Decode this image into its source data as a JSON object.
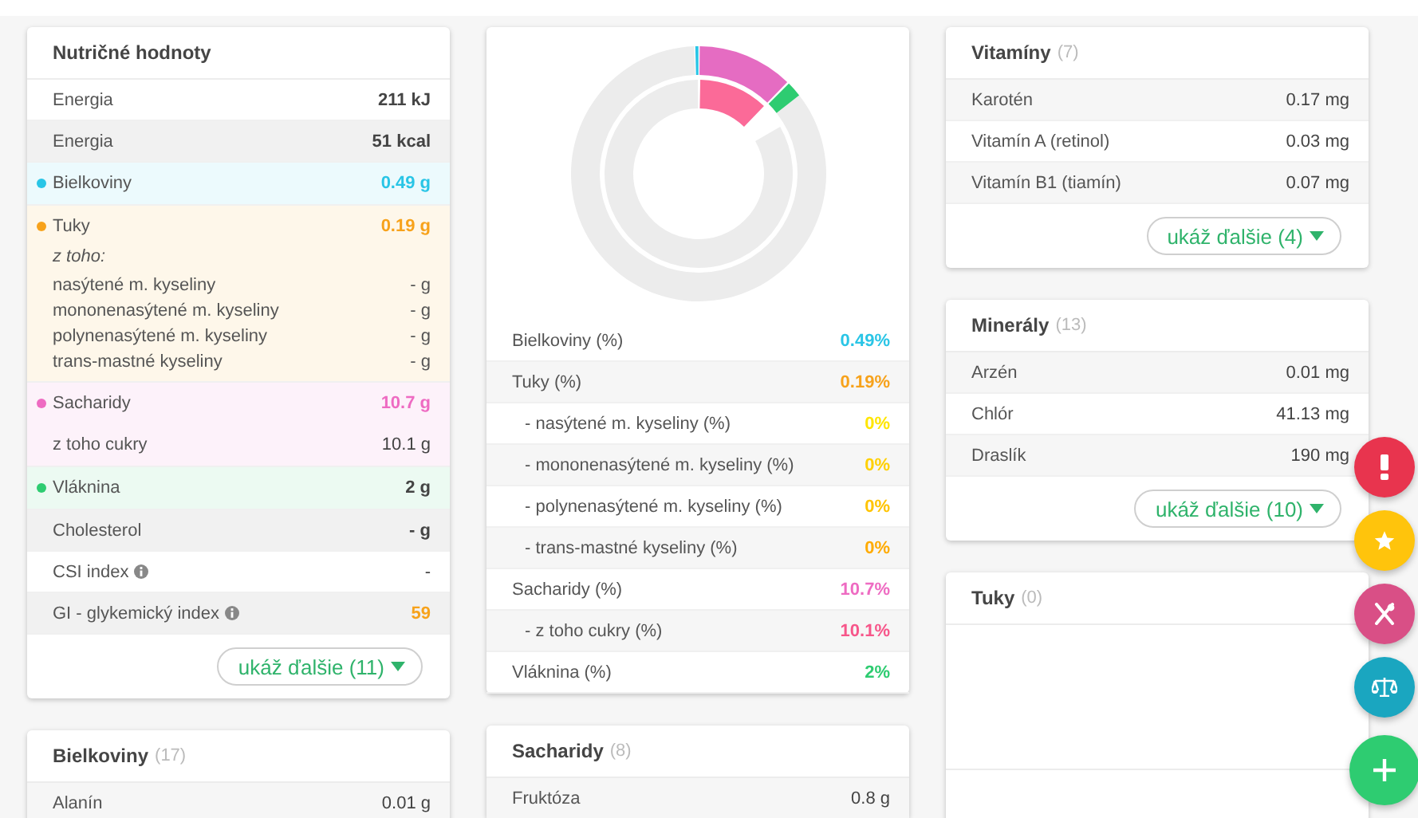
{
  "columns": [
    [
      {
        "kind": "nutrition",
        "title": "Nutričné hodnoty",
        "rows": [
          {
            "kind": "row",
            "label": "Energia",
            "value": "211 kJ",
            "strong": true,
            "shaded": false
          },
          {
            "kind": "row",
            "label": "Energia",
            "value": "51 kcal",
            "strong": true,
            "shaded": true
          },
          {
            "kind": "group",
            "color": "#29c5e6",
            "label": "Bielkoviny",
            "value": "0.49 g",
            "accent": true
          },
          {
            "kind": "group",
            "color": "#f7a21b",
            "label": "Tuky",
            "value": "0.19 g",
            "accent": true,
            "note": "z toho:",
            "details": [
              {
                "label": "nasýtené m. kyseliny",
                "value": "- g"
              },
              {
                "label": "mononenasýtené m. kyseliny",
                "value": "- g"
              },
              {
                "label": "polynenasýtené m. kyseliny",
                "value": "- g"
              },
              {
                "label": "trans-mastné kyseliny",
                "value": "- g"
              }
            ]
          },
          {
            "kind": "group",
            "color": "#ee6bc2",
            "label": "Sacharidy",
            "value": "10.7 g",
            "accent": true,
            "subrows": [
              {
                "label": "z toho cukry",
                "value": "10.1 g"
              }
            ]
          },
          {
            "kind": "group",
            "color": "#2ecc71",
            "label": "Vláknina",
            "value": "2 g",
            "accent": false
          },
          {
            "kind": "row",
            "label": "Cholesterol",
            "value": "- g",
            "strong": true,
            "shaded": true
          },
          {
            "kind": "row",
            "label": "CSI index",
            "info": true,
            "value": "-",
            "strong": false,
            "shaded": false
          },
          {
            "kind": "row",
            "label": "GI - glykemický index",
            "info": true,
            "value": "59",
            "strong": true,
            "shaded": true,
            "color": "#f7a21b"
          }
        ],
        "more": "ukáž ďalšie (11)"
      },
      {
        "kind": "list",
        "title": "Bielkoviny",
        "count": "(17)",
        "rows": [
          {
            "label": "Alanín",
            "value": "0.01 g"
          }
        ]
      }
    ],
    [
      {
        "kind": "percent",
        "rows": [
          {
            "label": "Bielkoviny (%)",
            "value": "0.49%",
            "color": "#29c5e6"
          },
          {
            "label": "Tuky (%)",
            "value": "0.19%",
            "color": "#f7a21b",
            "children": [
              {
                "label": "- nasýtené m. kyseliny (%)",
                "value": "0%",
                "color": "#ffe600"
              },
              {
                "label": "- mononenasýtené m. kyseliny (%)",
                "value": "0%",
                "color": "#ffd000"
              },
              {
                "label": "- polynenasýtené m. kyseliny (%)",
                "value": "0%",
                "color": "#ffc400"
              },
              {
                "label": "- trans-mastné kyseliny (%)",
                "value": "0%",
                "color": "#ffab00"
              }
            ]
          },
          {
            "label": "Sacharidy (%)",
            "value": "10.7%",
            "color": "#ee6bc2",
            "children": [
              {
                "label": "- z toho cukry (%)",
                "value": "10.1%",
                "color": "#f7568a"
              }
            ]
          },
          {
            "label": "Vláknina (%)",
            "value": "2%",
            "color": "#2ecc71"
          }
        ]
      },
      {
        "kind": "list",
        "title": "Sacharidy",
        "count": "(8)",
        "rows": [
          {
            "label": "Fruktóza",
            "value": "0.8 g"
          }
        ]
      }
    ],
    [
      {
        "kind": "list",
        "title": "Vitamíny",
        "count": "(7)",
        "rows": [
          {
            "label": "Karotén",
            "value": "0.17 mg"
          },
          {
            "label": "Vitamín A (retinol)",
            "value": "0.03 mg"
          },
          {
            "label": "Vitamín B1 (tiamín)",
            "value": "0.07 mg"
          }
        ],
        "more": "ukáž ďalšie (4)"
      },
      {
        "kind": "list",
        "title": "Minerály",
        "count": "(13)",
        "rows": [
          {
            "label": "Arzén",
            "value": "0.01 mg"
          },
          {
            "label": "Chlór",
            "value": "41.13 mg"
          },
          {
            "label": "Draslík",
            "value": "190 mg"
          }
        ],
        "more": "ukáž ďalšie (10)"
      },
      {
        "kind": "list",
        "title": "Tuky",
        "count": "(0)"
      }
    ]
  ],
  "actions": [
    {
      "kind": "alert",
      "color": "#e8344e"
    },
    {
      "kind": "favorite",
      "color": "#ffc40c"
    },
    {
      "kind": "meal",
      "color": "#d94f86"
    },
    {
      "kind": "compare",
      "color": "#1aa6c0"
    },
    {
      "kind": "add",
      "color": "#2ecc71"
    }
  ]
}
